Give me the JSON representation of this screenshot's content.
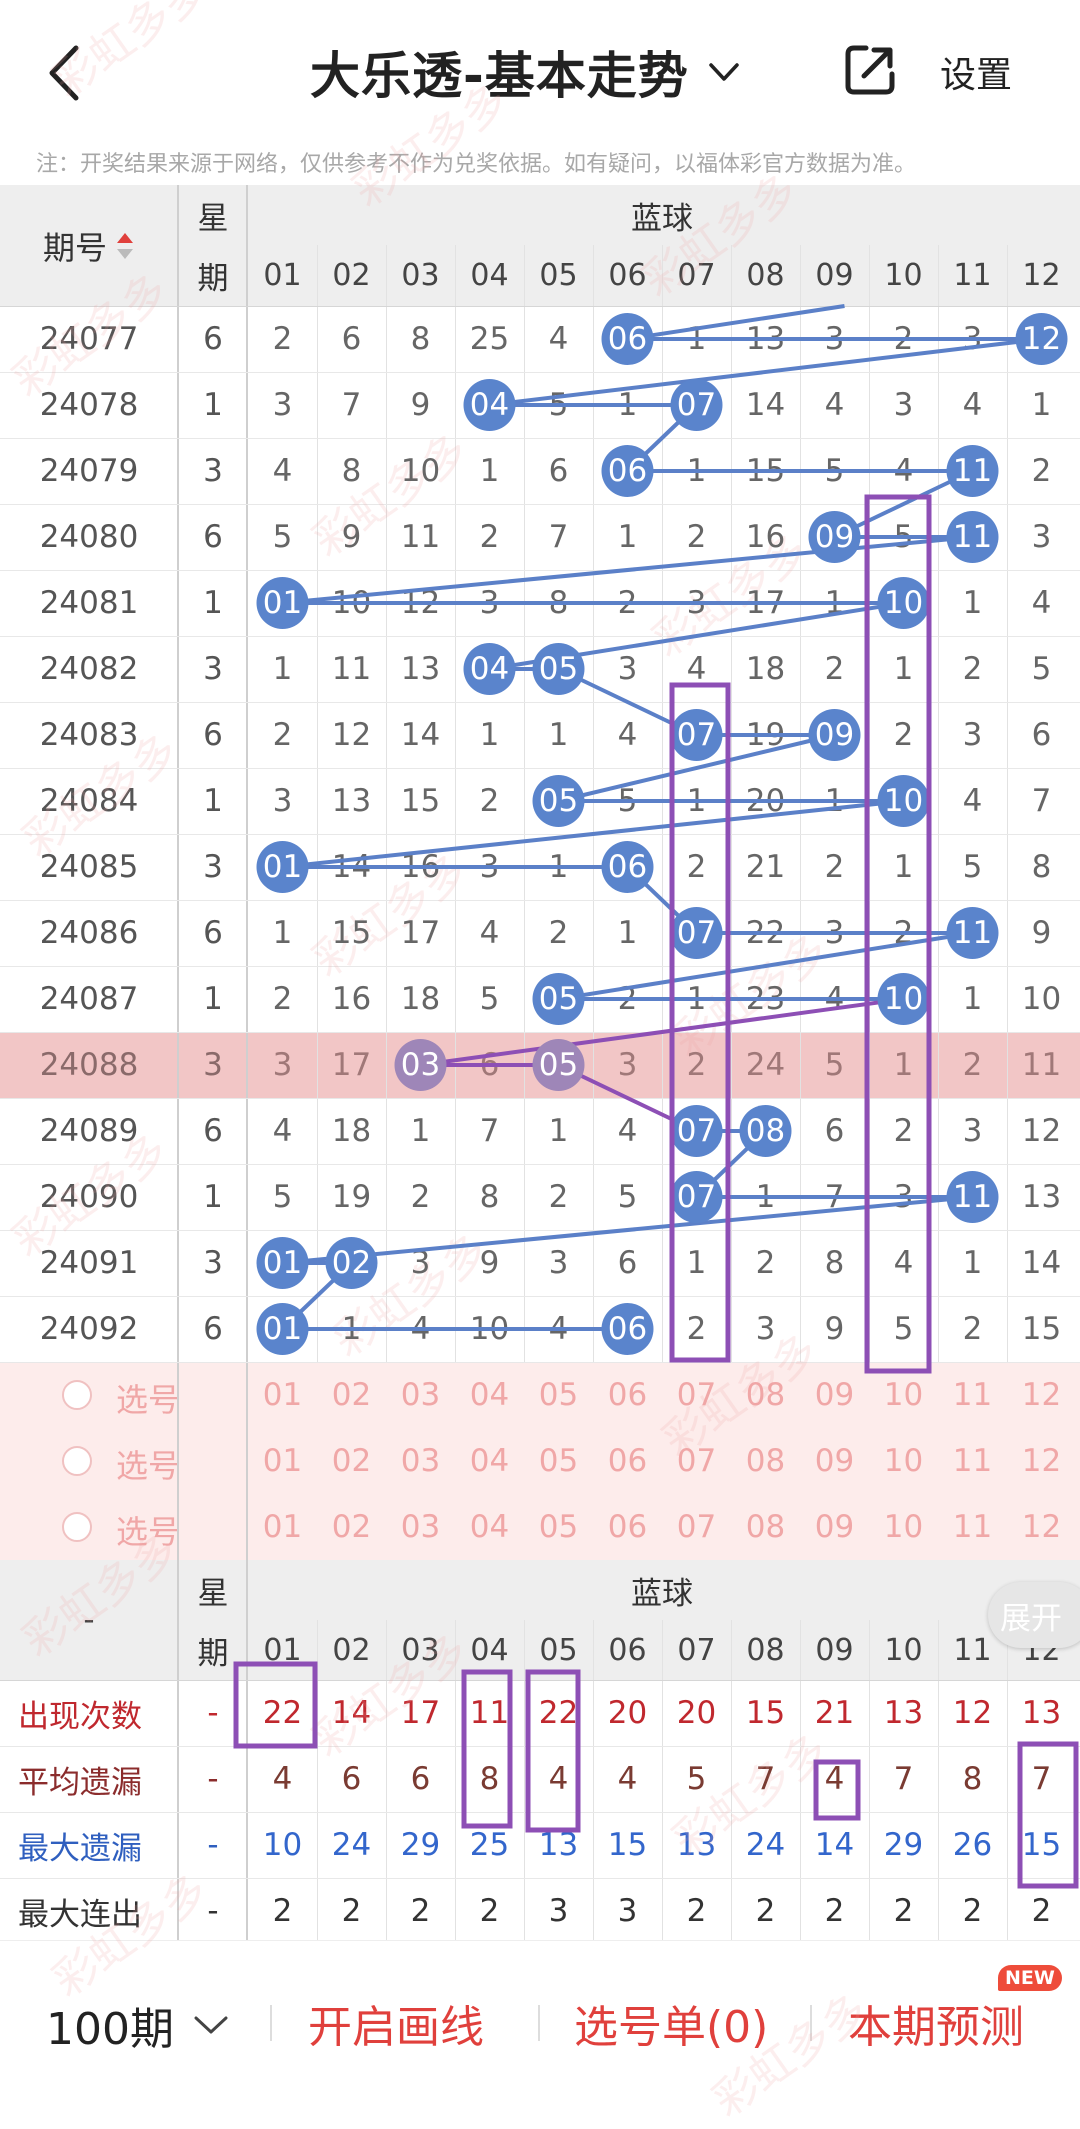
{
  "header": {
    "title": "大乐透-基本走势",
    "settings_label": "设置",
    "notice": "注：开奖结果来源于网络，仅供参考不作为兑奖依据。如有疑问，以福体彩官方数据为准。"
  },
  "table": {
    "col_period_label": "期号",
    "col_weekday_label_top": "星",
    "col_weekday_label_bottom": "期",
    "blue_label": "蓝球",
    "columns": [
      "01",
      "02",
      "03",
      "04",
      "05",
      "06",
      "07",
      "08",
      "09",
      "10",
      "11",
      "12"
    ],
    "rows": [
      {
        "period": "24077",
        "weekday": "6",
        "cells": [
          "2",
          "6",
          "8",
          "25",
          "4",
          "06",
          "1",
          "13",
          "3",
          "2",
          "3",
          "12"
        ],
        "hits": [
          6,
          12
        ]
      },
      {
        "period": "24078",
        "weekday": "1",
        "cells": [
          "3",
          "7",
          "9",
          "04",
          "5",
          "1",
          "07",
          "14",
          "4",
          "3",
          "4",
          "1"
        ],
        "hits": [
          4,
          7
        ]
      },
      {
        "period": "24079",
        "weekday": "3",
        "cells": [
          "4",
          "8",
          "10",
          "1",
          "6",
          "06",
          "1",
          "15",
          "5",
          "4",
          "11",
          "2"
        ],
        "hits": [
          6,
          11
        ]
      },
      {
        "period": "24080",
        "weekday": "6",
        "cells": [
          "5",
          "9",
          "11",
          "2",
          "7",
          "1",
          "2",
          "16",
          "09",
          "5",
          "11",
          "3"
        ],
        "hits": [
          9,
          11
        ]
      },
      {
        "period": "24081",
        "weekday": "1",
        "cells": [
          "01",
          "10",
          "12",
          "3",
          "8",
          "2",
          "3",
          "17",
          "1",
          "10",
          "1",
          "4"
        ],
        "hits": [
          1,
          10
        ]
      },
      {
        "period": "24082",
        "weekday": "3",
        "cells": [
          "1",
          "11",
          "13",
          "04",
          "05",
          "3",
          "4",
          "18",
          "2",
          "1",
          "2",
          "5"
        ],
        "hits": [
          4,
          5
        ]
      },
      {
        "period": "24083",
        "weekday": "6",
        "cells": [
          "2",
          "12",
          "14",
          "1",
          "1",
          "4",
          "07",
          "19",
          "09",
          "2",
          "3",
          "6"
        ],
        "hits": [
          7,
          9
        ]
      },
      {
        "period": "24084",
        "weekday": "1",
        "cells": [
          "3",
          "13",
          "15",
          "2",
          "05",
          "5",
          "1",
          "20",
          "1",
          "10",
          "4",
          "7"
        ],
        "hits": [
          5,
          10
        ]
      },
      {
        "period": "24085",
        "weekday": "3",
        "cells": [
          "01",
          "14",
          "16",
          "3",
          "1",
          "06",
          "2",
          "21",
          "2",
          "1",
          "5",
          "8"
        ],
        "hits": [
          1,
          6
        ]
      },
      {
        "period": "24086",
        "weekday": "6",
        "cells": [
          "1",
          "15",
          "17",
          "4",
          "2",
          "1",
          "07",
          "22",
          "3",
          "2",
          "11",
          "9"
        ],
        "hits": [
          7,
          11
        ]
      },
      {
        "period": "24087",
        "weekday": "1",
        "cells": [
          "2",
          "16",
          "18",
          "5",
          "05",
          "2",
          "1",
          "23",
          "4",
          "10",
          "1",
          "10"
        ],
        "hits": [
          5,
          10
        ]
      },
      {
        "period": "24088",
        "weekday": "3",
        "cells": [
          "3",
          "17",
          "03",
          "6",
          "05",
          "3",
          "2",
          "24",
          "5",
          "1",
          "2",
          "11"
        ],
        "hits": [
          3,
          5
        ],
        "highlight": true
      },
      {
        "period": "24089",
        "weekday": "6",
        "cells": [
          "4",
          "18",
          "1",
          "7",
          "1",
          "4",
          "07",
          "08",
          "6",
          "2",
          "3",
          "12"
        ],
        "hits": [
          7,
          8
        ]
      },
      {
        "period": "24090",
        "weekday": "1",
        "cells": [
          "5",
          "19",
          "2",
          "8",
          "2",
          "5",
          "07",
          "1",
          "7",
          "3",
          "11",
          "13"
        ],
        "hits": [
          7,
          11
        ]
      },
      {
        "period": "24091",
        "weekday": "3",
        "cells": [
          "01",
          "02",
          "3",
          "9",
          "3",
          "6",
          "1",
          "2",
          "8",
          "4",
          "1",
          "14"
        ],
        "hits": [
          1,
          2
        ]
      },
      {
        "period": "24092",
        "weekday": "6",
        "cells": [
          "01",
          "1",
          "4",
          "10",
          "4",
          "06",
          "2",
          "3",
          "9",
          "5",
          "2",
          "15"
        ],
        "hits": [
          1,
          6
        ]
      }
    ],
    "select_label": "选号",
    "select_rows": 3
  },
  "stats": {
    "dash": "-",
    "weekday_top": "星",
    "weekday_bottom": "期",
    "blue_label": "蓝球",
    "expand_label": "展开",
    "rows": [
      {
        "label": "出现次数",
        "color": "#c0282e",
        "value_color": "#c0282e",
        "weekday": "-",
        "values": [
          "22",
          "14",
          "17",
          "11",
          "22",
          "20",
          "20",
          "15",
          "21",
          "13",
          "12",
          "13"
        ]
      },
      {
        "label": "平均遗漏",
        "color": "#8b2c2c",
        "value_color": "#7a3b32",
        "weekday": "-",
        "values": [
          "4",
          "6",
          "6",
          "8",
          "4",
          "4",
          "5",
          "7",
          "4",
          "7",
          "8",
          "7"
        ]
      },
      {
        "label": "最大遗漏",
        "color": "#2f5fbf",
        "value_color": "#3366cc",
        "weekday": "-",
        "values": [
          "10",
          "24",
          "29",
          "25",
          "13",
          "15",
          "13",
          "24",
          "14",
          "29",
          "26",
          "15"
        ]
      },
      {
        "label": "最大连出",
        "color": "#333333",
        "value_color": "#333333",
        "weekday": "-",
        "values": [
          "2",
          "2",
          "2",
          "2",
          "3",
          "3",
          "2",
          "2",
          "2",
          "2",
          "2",
          "2"
        ]
      }
    ]
  },
  "bottom_bar": {
    "period": "100期",
    "draw_line": "开启画线",
    "selection": "选号单(0)",
    "predict": "本期预测",
    "new_badge": "NEW"
  },
  "watermark_text": "彩虹多多",
  "colors": {
    "ball": "#5a84cc",
    "ball_dim": "#9e86b8",
    "line": "#5b80c8",
    "box": "#8d4fb5",
    "accent_red": "#e0403c",
    "highlight_row": "#f2c6c6"
  }
}
